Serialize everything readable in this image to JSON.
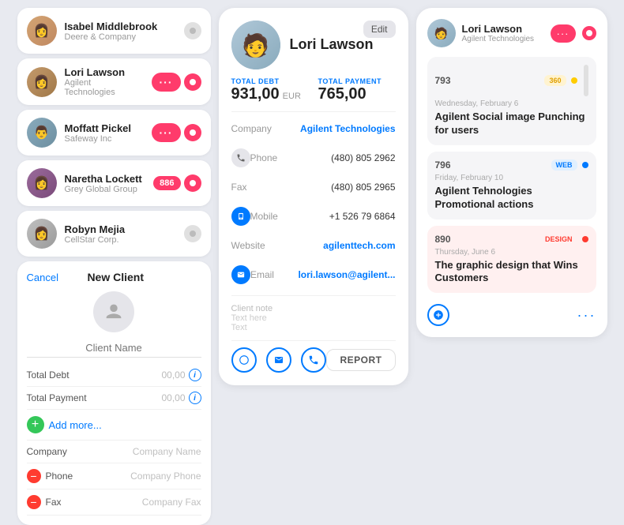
{
  "contacts": [
    {
      "id": 1,
      "name": "Isabel Middlebrook",
      "company": "Deere & Company",
      "badge": "toggle",
      "active": false,
      "color": "face-1"
    },
    {
      "id": 2,
      "name": "Lori Lawson",
      "company": "Agilent Technologies",
      "badge": "pill",
      "active": true,
      "color": "face-2"
    },
    {
      "id": 3,
      "name": "Moffatt Pickel",
      "company": "Safeway Inc",
      "badge": "pill",
      "active": true,
      "color": "face-3"
    },
    {
      "id": 4,
      "name": "Naretha Lockett",
      "company": "Grey Global Group",
      "badge": "number",
      "number": "886",
      "active": true,
      "color": "face-4"
    },
    {
      "id": 5,
      "name": "Robyn Mejia",
      "company": "CellStar Corp.",
      "badge": "toggle",
      "active": false,
      "color": "face-5"
    }
  ],
  "newClient": {
    "title": "New Client",
    "cancel": "Cancel",
    "namePlaceholder": "Client Name",
    "totalDebt": {
      "label": "Total Debt",
      "value": "00,00"
    },
    "totalPayment": {
      "label": "Total Payment",
      "value": "00,00"
    },
    "addMore": "Add more...",
    "fields": [
      {
        "label": "Company",
        "placeholder": "Company Name"
      },
      {
        "label": "Phone",
        "placeholder": "Company Phone"
      },
      {
        "label": "Fax",
        "placeholder": "Company Fax"
      }
    ]
  },
  "clientDetail": {
    "name": "Lori Lawson",
    "editLabel": "Edit",
    "totalDebt": {
      "label": "TOTAL DEBT",
      "value": "931,00",
      "currency": "EUR"
    },
    "totalPayment": {
      "label": "TOTAL PAYMENT",
      "value": "765,00"
    },
    "company": {
      "label": "Company",
      "value": "Agilent Technologies"
    },
    "phone": {
      "label": "Phone",
      "value": "(480) 805 2962"
    },
    "fax": {
      "label": "Fax",
      "value": "(480) 805 2965"
    },
    "mobile": {
      "label": "Mobile",
      "value": "+1 526 79 6864"
    },
    "website": {
      "label": "Website",
      "value": "agilenttech.com"
    },
    "email": {
      "label": "Email",
      "value": "lori.lawson@agilent..."
    },
    "clientNote": "Client note",
    "noteText1": "Text here",
    "noteText2": "Text",
    "reportLabel": "REPORT"
  },
  "rightPanel": {
    "name": "Lori Lawson",
    "company": "Agilent Technologies",
    "tasks": [
      {
        "id": "793",
        "badge": "360",
        "badgeType": "badge-360",
        "dotType": "dot-yellow",
        "date": "Wednesday, February 6",
        "title": "Agilent Social image Punching for users"
      },
      {
        "id": "796",
        "badge": "WEB",
        "badgeType": "badge-web",
        "dotType": "dot-blue",
        "date": "Friday, February 10",
        "title": "Agilent Tehnologies Promotional actions"
      },
      {
        "id": "890",
        "badge": "DESIGN",
        "badgeType": "badge-design",
        "dotType": "dot-red",
        "date": "Thursday, June 6",
        "title": "The graphic design that Wins Customers"
      }
    ]
  }
}
